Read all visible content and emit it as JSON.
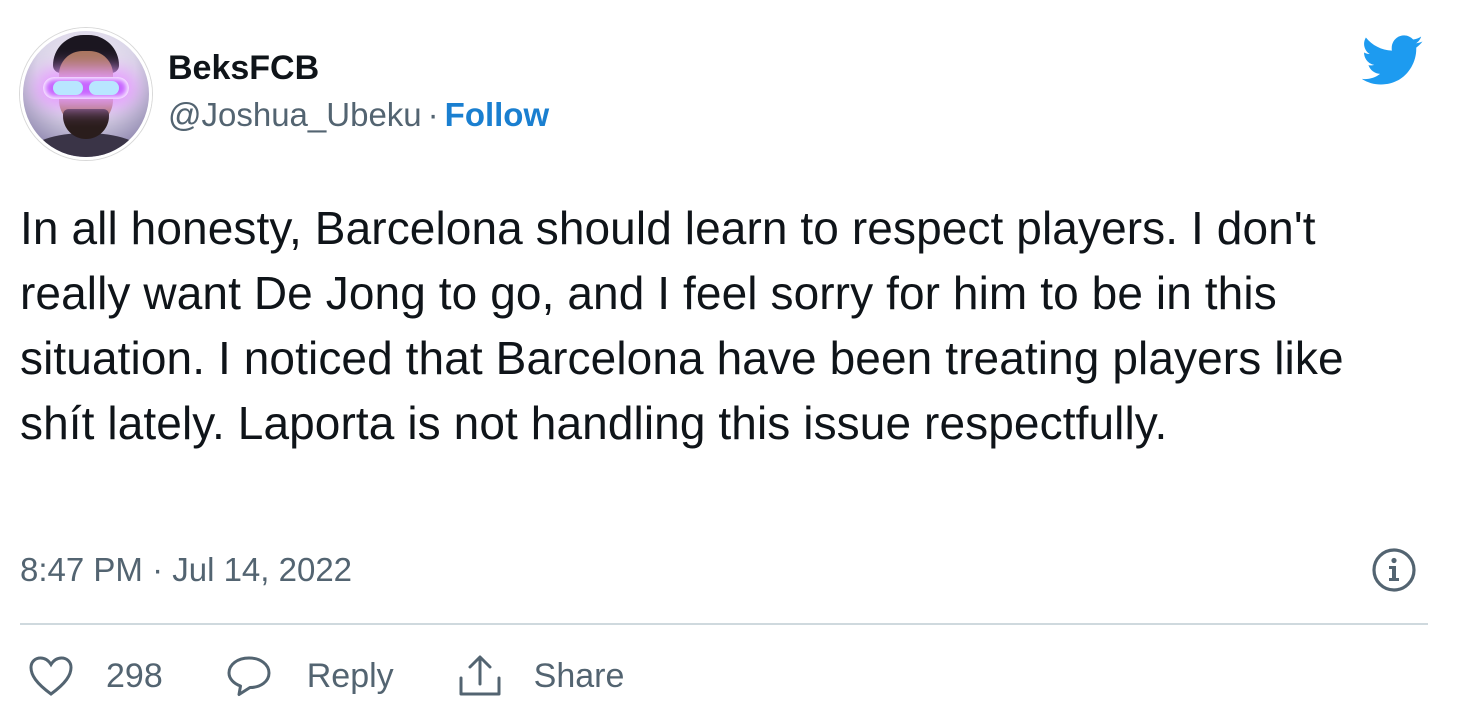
{
  "tweet": {
    "display_name": "BeksFCB",
    "handle": "@Joshua_Ubeku",
    "separator": "·",
    "follow_label": "Follow",
    "body": "In all honesty, Barcelona should learn to respect players. I don't really want De Jong to go, and I feel sorry for him to be in this situation. I noticed that Barcelona have been treating players like shít lately. Laporta is not handling this issue respectfully.",
    "timestamp": "8:47 PM · Jul 14, 2022"
  },
  "actions": {
    "like_count": "298",
    "reply_label": "Reply",
    "share_label": "Share"
  },
  "icons": {
    "logo": "twitter-bird-icon",
    "info": "info-icon",
    "like": "heart-icon",
    "reply": "speech-bubble-icon",
    "share": "share-upload-icon"
  },
  "colors": {
    "brand": "#1d9bf0",
    "follow": "#1a7fd0",
    "secondary_text": "#536471",
    "primary_text": "#0f1419",
    "divider": "#cfd9de"
  }
}
